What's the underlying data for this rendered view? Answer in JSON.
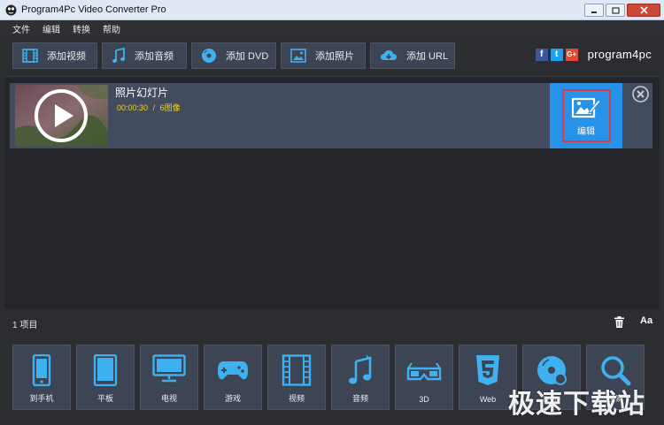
{
  "window": {
    "title": "Program4Pc Video Converter Pro"
  },
  "menu": [
    "文件",
    "编辑",
    "转换",
    "帮助"
  ],
  "toolbar": {
    "buttons": [
      {
        "label": "添加视频",
        "icon": "film-icon"
      },
      {
        "label": "添加音频",
        "icon": "music-note-icon"
      },
      {
        "label": "添加 DVD",
        "icon": "disc-icon"
      },
      {
        "label": "添加照片",
        "icon": "image-icon"
      },
      {
        "label": "添加 URL",
        "icon": "cloud-download-icon"
      }
    ],
    "social": [
      "f",
      "t",
      "G+"
    ],
    "brand": "program4pc"
  },
  "item": {
    "title": "照片幻灯片",
    "duration": "00:00:30",
    "separator": "/",
    "images": "6图像",
    "edit_label": "编辑"
  },
  "status": {
    "count": "1 项目",
    "font_button": "Aa"
  },
  "formats": [
    {
      "label": "到手机",
      "icon": "phone-icon"
    },
    {
      "label": "平板",
      "icon": "tablet-icon"
    },
    {
      "label": "电视",
      "icon": "tv-icon"
    },
    {
      "label": "游戏",
      "icon": "gamepad-icon"
    },
    {
      "label": "视频",
      "icon": "film-icon"
    },
    {
      "label": "音频",
      "icon": "music-notes-icon"
    },
    {
      "label": "3D",
      "icon": "3d-glasses-icon"
    },
    {
      "label": "Web",
      "icon": "html5-icon"
    },
    {
      "label": "DVD",
      "icon": "dvd-icon"
    },
    {
      "label": "搜索",
      "icon": "search-icon"
    }
  ],
  "watermark": "极速下载站",
  "colors": {
    "accent": "#2891e8",
    "highlight": "#f3d21c",
    "edit_border": "#d83a4c"
  }
}
